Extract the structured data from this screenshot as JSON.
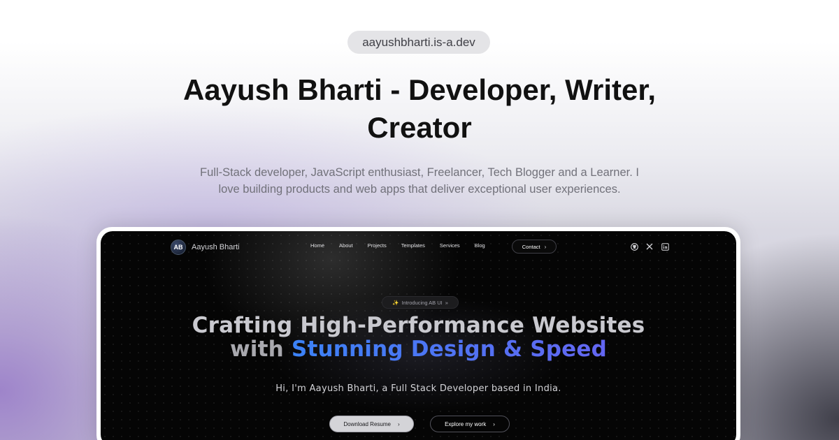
{
  "domain_pill": "aayushbharti.is-a.dev",
  "headline": "Aayush Bharti - Developer, Writer, Creator",
  "subtext": "Full-Stack developer, JavaScript enthusiast, Freelancer, Tech Blogger and a Learner. I love building products and web apps that deliver exceptional user experiences.",
  "preview": {
    "logo_mark": "AB",
    "logo_text": "Aayush Bharti",
    "nav_links": [
      "Home",
      "About",
      "Projects",
      "Templates",
      "Services",
      "Blog"
    ],
    "contact_label": "Contact",
    "chevron": "›",
    "badge_sparkle": "✨",
    "badge_text": "Introducing AB UI",
    "badge_arrow": "»",
    "hero_line1": "Crafting High-Performance Websites",
    "hero_line2_plain": "with ",
    "hero_line2_accent": "Stunning Design & Speed",
    "hero_sub": "Hi, I'm Aayush Bharti, a Full Stack Developer based in India.",
    "primary_button": "Download Resume",
    "secondary_button": "Explore my work",
    "social_icons": [
      "github-icon",
      "x-icon",
      "linkedin-icon"
    ]
  },
  "colors": {
    "accent_blue": "#3b82f6",
    "accent_indigo": "#6366f1",
    "screen_bg": "#050505"
  }
}
